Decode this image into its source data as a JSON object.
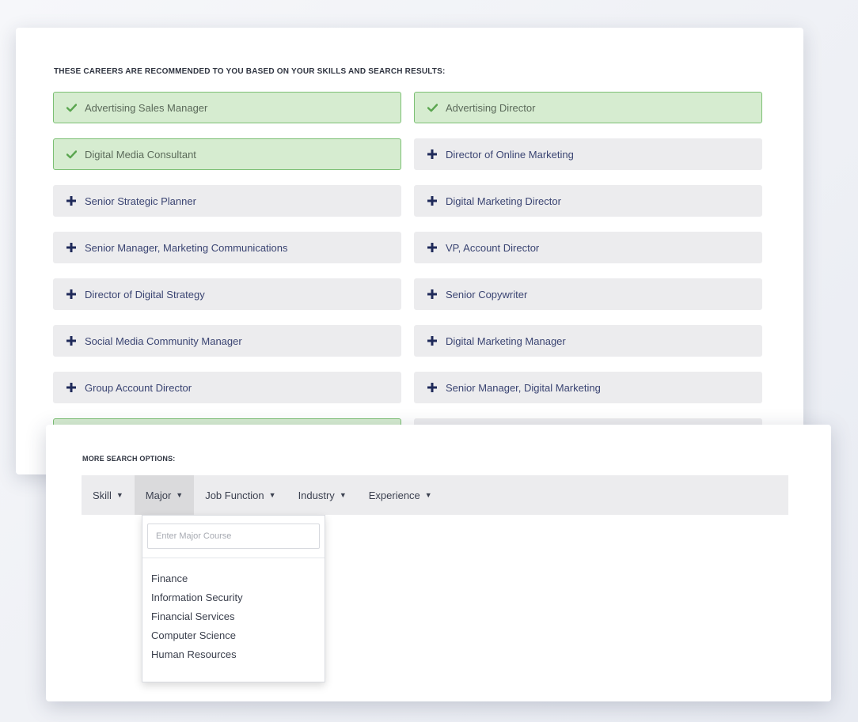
{
  "recommendations": {
    "heading": "THESE CAREERS ARE RECOMMENDED TO YOU BASED ON YOUR SKILLS AND SEARCH RESULTS:",
    "items": [
      {
        "label": "Advertising Sales Manager",
        "selected": true
      },
      {
        "label": "Advertising Director",
        "selected": true
      },
      {
        "label": "Digital Media Consultant",
        "selected": true
      },
      {
        "label": "Director of Online Marketing",
        "selected": false
      },
      {
        "label": "Senior Strategic Planner",
        "selected": false
      },
      {
        "label": "Digital Marketing Director",
        "selected": false
      },
      {
        "label": "Senior Manager, Marketing Communications",
        "selected": false
      },
      {
        "label": "VP, Account Director",
        "selected": false
      },
      {
        "label": "Director of Digital Strategy",
        "selected": false
      },
      {
        "label": "Senior Copywriter",
        "selected": false
      },
      {
        "label": "Social Media Community Manager",
        "selected": false
      },
      {
        "label": "Digital Marketing Manager",
        "selected": false
      },
      {
        "label": "Group Account Director",
        "selected": false
      },
      {
        "label": "Senior Manager, Digital Marketing",
        "selected": false
      },
      {
        "label": "",
        "selected": true
      },
      {
        "label": "",
        "selected": false
      }
    ]
  },
  "search_options": {
    "label": "MORE SEARCH OPTIONS:",
    "menu": [
      {
        "label": "Skill",
        "caret": "▼"
      },
      {
        "label": "Major",
        "caret": "▼"
      },
      {
        "label": "Job Function",
        "caret": "▼"
      },
      {
        "label": "Industry",
        "caret": "▼"
      },
      {
        "label": "Experience",
        "caret": "▼"
      }
    ],
    "active_menu": "Major",
    "dropdown": {
      "placeholder": "Enter Major Course",
      "value": "",
      "options": [
        "Finance",
        "Information Security",
        "Financial Services",
        "Computer Science",
        "Human Resources"
      ]
    }
  },
  "icons": {
    "selected": "checkmark-icon",
    "unselected": "plus-icon"
  },
  "colors": {
    "selected_bg": "#d6ecd0",
    "selected_border": "#7cc074",
    "check": "#5aa54f",
    "plus": "#1f2a5a",
    "label_text": "#3a4472"
  }
}
